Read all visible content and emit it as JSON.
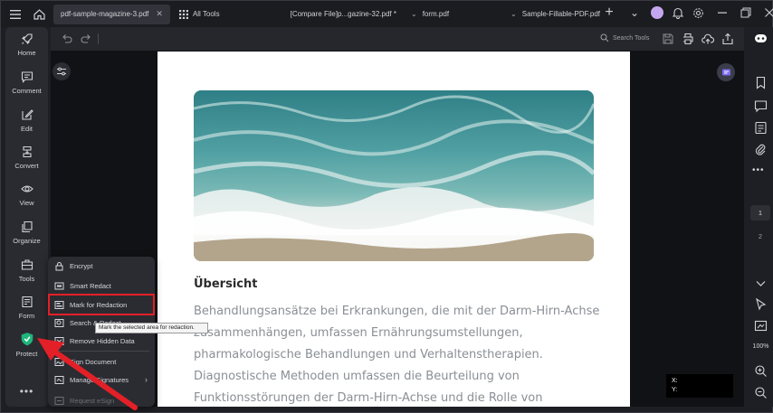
{
  "tabs": [
    {
      "label": "pdf-sample-magazine-3.pdf",
      "active": true
    },
    {
      "label": "All Tools"
    },
    {
      "label": "[Compare  File]p...gazine-32.pdf *"
    },
    {
      "label": "form.pdf"
    },
    {
      "label": "Sample-Fillable-PDF.pdf"
    }
  ],
  "nav": [
    {
      "label": "Home",
      "icon": "rocket-icon"
    },
    {
      "label": "Comment",
      "icon": "comment-icon"
    },
    {
      "label": "Edit",
      "icon": "edit-icon"
    },
    {
      "label": "Convert",
      "icon": "convert-icon"
    },
    {
      "label": "View",
      "icon": "eye-icon"
    },
    {
      "label": "Organize",
      "icon": "organize-icon"
    },
    {
      "label": "Tools",
      "icon": "toolbox-icon"
    },
    {
      "label": "Form",
      "icon": "form-icon"
    },
    {
      "label": "Protect",
      "icon": "shield-icon"
    }
  ],
  "nav_more": "•••",
  "toolbar": {
    "search_label": "Search Tools"
  },
  "document": {
    "heading": "Übersicht",
    "lines": [
      "Behandlungsansätze bei Erkrankungen, die mit der Darm-Hirn-Achse",
      "zusammenhängen, umfassen Ernährungsumstellungen,",
      "pharmakologische Behandlungen und Verhaltenstherapien.",
      "Diagnostische Methoden umfassen die Beurteilung von",
      "Funktionsstörungen der Darm-Hirn-Achse und die Rolle von"
    ]
  },
  "protect_menu": {
    "items": [
      {
        "label": "Encrypt",
        "icon": "lock-icon"
      },
      {
        "label": "Smart Redact",
        "icon": "smart-redact-icon"
      },
      {
        "label": "Mark for Redaction",
        "icon": "mark-redaction-icon"
      },
      {
        "label": "Search & Redact",
        "icon": "search-redact-icon"
      },
      {
        "label": "Remove Hidden Data",
        "icon": "remove-data-icon"
      },
      {
        "label": "Sign Document",
        "icon": "sign-icon"
      },
      {
        "label": "Manage Signatures",
        "icon": "signatures-icon",
        "arrow": "›"
      },
      {
        "label": "Request eSign",
        "icon": "esign-icon",
        "disabled": true
      }
    ],
    "tooltip": "Mark the selected area for redaction."
  },
  "right_rail": {
    "pages": [
      "1",
      "2"
    ],
    "zoom": "100%"
  },
  "coords": {
    "x": "X:",
    "y": "Y:"
  },
  "colors": {
    "accent": "#e32027",
    "protect_green": "#1fb57a",
    "avatar": "#c4a6f0"
  }
}
